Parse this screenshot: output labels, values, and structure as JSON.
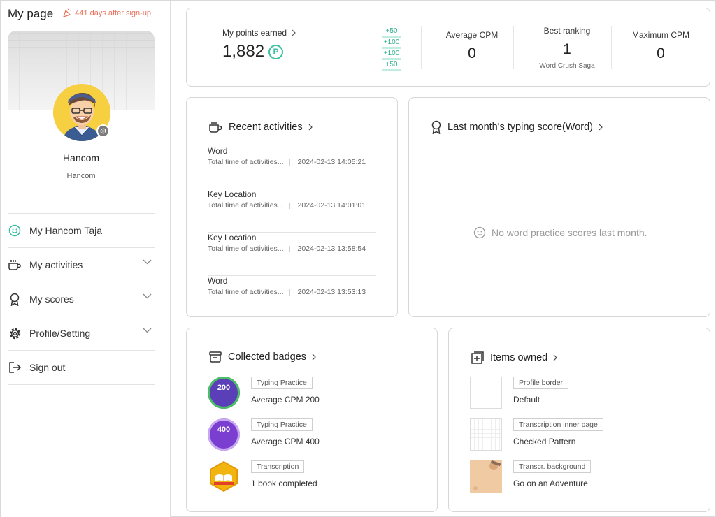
{
  "sidebar": {
    "title": "My page",
    "days": "441 days after sign-up",
    "name": "Hancom",
    "sub": "Hancom",
    "items": [
      {
        "label": "My Hancom Taja"
      },
      {
        "label": "My activities"
      },
      {
        "label": "My scores"
      },
      {
        "label": "Profile/Setting"
      },
      {
        "label": "Sign out"
      }
    ]
  },
  "points": {
    "label": "My points earned",
    "value": "1,882",
    "p_symbol": "P",
    "deltas": [
      "+50",
      "+100",
      "+100",
      "+50"
    ]
  },
  "stats": [
    {
      "label": "Average CPM",
      "value": "0"
    },
    {
      "label": "Best ranking",
      "value": "1",
      "sub": "Word Crush Saga"
    },
    {
      "label": "Maximum CPM",
      "value": "0"
    }
  ],
  "recent": {
    "title": "Recent activities",
    "items": [
      {
        "name": "Word",
        "desc": "Total time of activities...",
        "time": "2024-02-13 14:05:21"
      },
      {
        "name": "Key Location",
        "desc": "Total time of activities...",
        "time": "2024-02-13 14:01:01"
      },
      {
        "name": "Key Location",
        "desc": "Total time of activities...",
        "time": "2024-02-13 13:58:54"
      },
      {
        "name": "Word",
        "desc": "Total time of activities...",
        "time": "2024-02-13 13:53:13"
      }
    ]
  },
  "score": {
    "title": "Last month's typing score(Word)",
    "empty": "No word practice scores last month."
  },
  "badges": {
    "title": "Collected badges",
    "items": [
      {
        "tag": "Typing Practice",
        "name": "Average CPM 200",
        "num": "200",
        "color": "#5a3fb8"
      },
      {
        "tag": "Typing Practice",
        "name": "Average CPM 400",
        "num": "400",
        "color": "#7a3fd0"
      },
      {
        "tag": "Transcription",
        "name": "1 book completed",
        "color": "#f2b50f"
      }
    ]
  },
  "items": {
    "title": "Items owned",
    "list": [
      {
        "tag": "Profile border",
        "name": "Default"
      },
      {
        "tag": "Transcription inner page",
        "name": "Checked Pattern"
      },
      {
        "tag": "Transcr. background",
        "name": "Go on an Adventure"
      }
    ]
  },
  "colors": {
    "accent": "#3cbf9f",
    "days": "#e8715a"
  }
}
